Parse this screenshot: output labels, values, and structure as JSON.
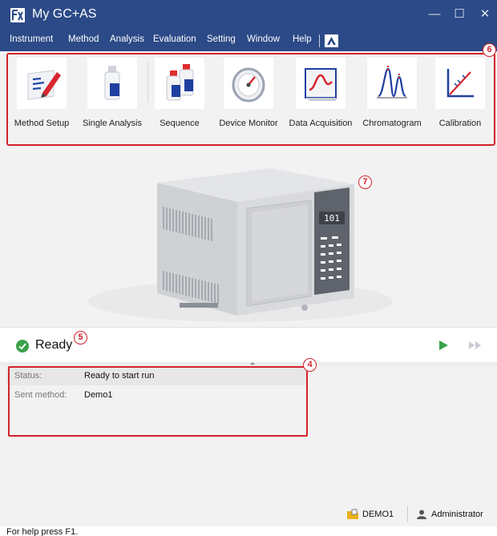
{
  "window": {
    "title": "My GC+AS"
  },
  "menu": [
    "Instrument",
    "Method",
    "Analysis",
    "Evaluation",
    "Setting",
    "Window",
    "Help"
  ],
  "toolbar": {
    "items": [
      {
        "label": "Method Setup",
        "icon": "method-setup-icon"
      },
      {
        "label": "Single Analysis",
        "icon": "single-analysis-icon"
      },
      {
        "label": "Sequence",
        "icon": "sequence-icon"
      },
      {
        "label": "Device Monitor",
        "icon": "device-monitor-icon"
      },
      {
        "label": "Data Acquisition",
        "icon": "data-acquisition-icon"
      },
      {
        "label": "Chromatogram",
        "icon": "chromatogram-icon"
      },
      {
        "label": "Calibration",
        "icon": "calibration-icon"
      }
    ]
  },
  "callouts": {
    "toolbar": "6",
    "instrument": "7",
    "ready": "5",
    "info": "4"
  },
  "instrument": {
    "display_value": "101"
  },
  "run": {
    "status": "Ready"
  },
  "info": {
    "rows": [
      {
        "key": "Status:",
        "value": "Ready to start run"
      },
      {
        "key": "Sent method:",
        "value": "Demo1"
      }
    ]
  },
  "footer": {
    "project": "DEMO1",
    "user": "Administrator",
    "help": "For help press F1."
  },
  "colors": {
    "titlebar": "#2b4a87",
    "accent_red": "#d2232a",
    "play_green": "#3aa14a"
  }
}
